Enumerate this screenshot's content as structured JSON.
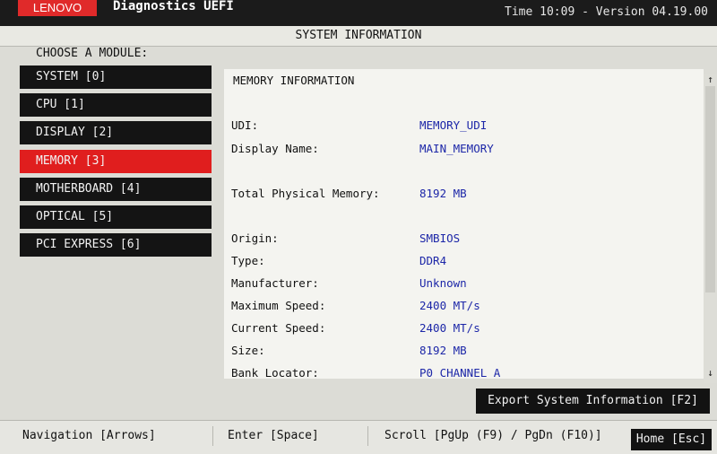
{
  "header": {
    "brand": "LENOVO",
    "app_title": "Diagnostics UEFI",
    "time_version": "Time 10:09 - Version 04.19.00"
  },
  "section_title": "SYSTEM INFORMATION",
  "modules": {
    "heading": "CHOOSE A MODULE:",
    "items": [
      {
        "label": "SYSTEM [0]"
      },
      {
        "label": "CPU [1]"
      },
      {
        "label": "DISPLAY [2]"
      },
      {
        "label": "MEMORY [3]"
      },
      {
        "label": "MOTHERBOARD [4]"
      },
      {
        "label": "OPTICAL [5]"
      },
      {
        "label": "PCI EXPRESS [6]"
      }
    ],
    "selected": "MEMORY [3]"
  },
  "memory": {
    "title": "MEMORY INFORMATION",
    "rows": [
      {
        "key": "UDI:",
        "value": "MEMORY_UDI"
      },
      {
        "key": "Display Name:",
        "value": "MAIN_MEMORY"
      },
      {
        "key": "Total Physical Memory:",
        "value": "8192 MB"
      },
      {
        "key": "Origin:",
        "value": "SMBIOS"
      },
      {
        "key": "Type:",
        "value": "DDR4"
      },
      {
        "key": "Manufacturer:",
        "value": "Unknown"
      },
      {
        "key": "Maximum Speed:",
        "value": "2400 MT/s"
      },
      {
        "key": "Current Speed:",
        "value": "2400 MT/s"
      },
      {
        "key": "Size:",
        "value": "8192 MB"
      },
      {
        "key": "Bank Locator:",
        "value": "P0 CHANNEL A"
      }
    ]
  },
  "scroll": {
    "up": "↑",
    "down": "↓"
  },
  "export_button": "Export System Information [F2]",
  "footer": {
    "navigation": "Navigation [Arrows]",
    "enter": "Enter [Space]",
    "scroll": "Scroll [PgUp (F9) / PgDn (F10)]",
    "home": "Home [Esc]"
  }
}
